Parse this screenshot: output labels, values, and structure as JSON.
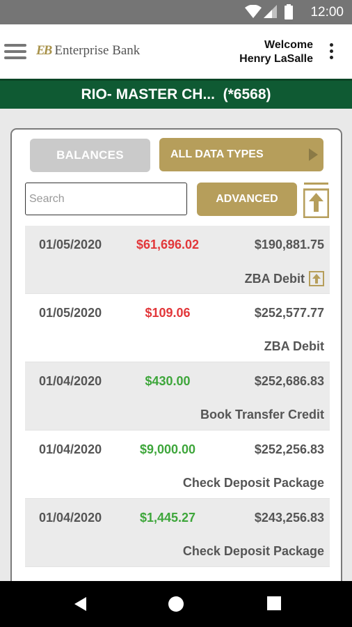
{
  "status_bar": {
    "time": "12:00"
  },
  "header": {
    "logo_mark": "EB",
    "logo_text": "Enterprise Bank",
    "welcome": "Welcome",
    "user_name": "Henry LaSalle"
  },
  "account": {
    "title": "RIO- MASTER CH...  (*6568)"
  },
  "toolbar": {
    "balances_label": "BALANCES",
    "data_types_label": "ALL DATA TYPES",
    "search_placeholder": "Search",
    "search_value": "",
    "advanced_label": "ADVANCED"
  },
  "transactions": [
    {
      "date": "01/05/2020",
      "amount": "$61,696.02",
      "type": "debit",
      "balance": "$190,881.75",
      "description": "ZBA Debit",
      "has_icon": true
    },
    {
      "date": "01/05/2020",
      "amount": "$109.06",
      "type": "debit",
      "balance": "$252,577.77",
      "description": "ZBA Debit",
      "has_icon": false
    },
    {
      "date": "01/04/2020",
      "amount": "$430.00",
      "type": "credit",
      "balance": "$252,686.83",
      "description": "Book Transfer Credit",
      "has_icon": false
    },
    {
      "date": "01/04/2020",
      "amount": "$9,000.00",
      "type": "credit",
      "balance": "$252,256.83",
      "description": "Check Deposit Package",
      "has_icon": false
    },
    {
      "date": "01/04/2020",
      "amount": "$1,445.27",
      "type": "credit",
      "balance": "$243,256.83",
      "description": "Check Deposit Package",
      "has_icon": false
    }
  ],
  "colors": {
    "brand_green": "#0f5a33",
    "gold": "#b69e5b",
    "debit_red": "#e2373a",
    "credit_green": "#3ea63b"
  },
  "icons": [
    "wifi-icon",
    "signal-icon",
    "battery-icon",
    "menu-icon",
    "more-vert-icon",
    "play-arrow-icon",
    "export-icon",
    "back-icon",
    "home-icon",
    "recents-icon"
  ]
}
